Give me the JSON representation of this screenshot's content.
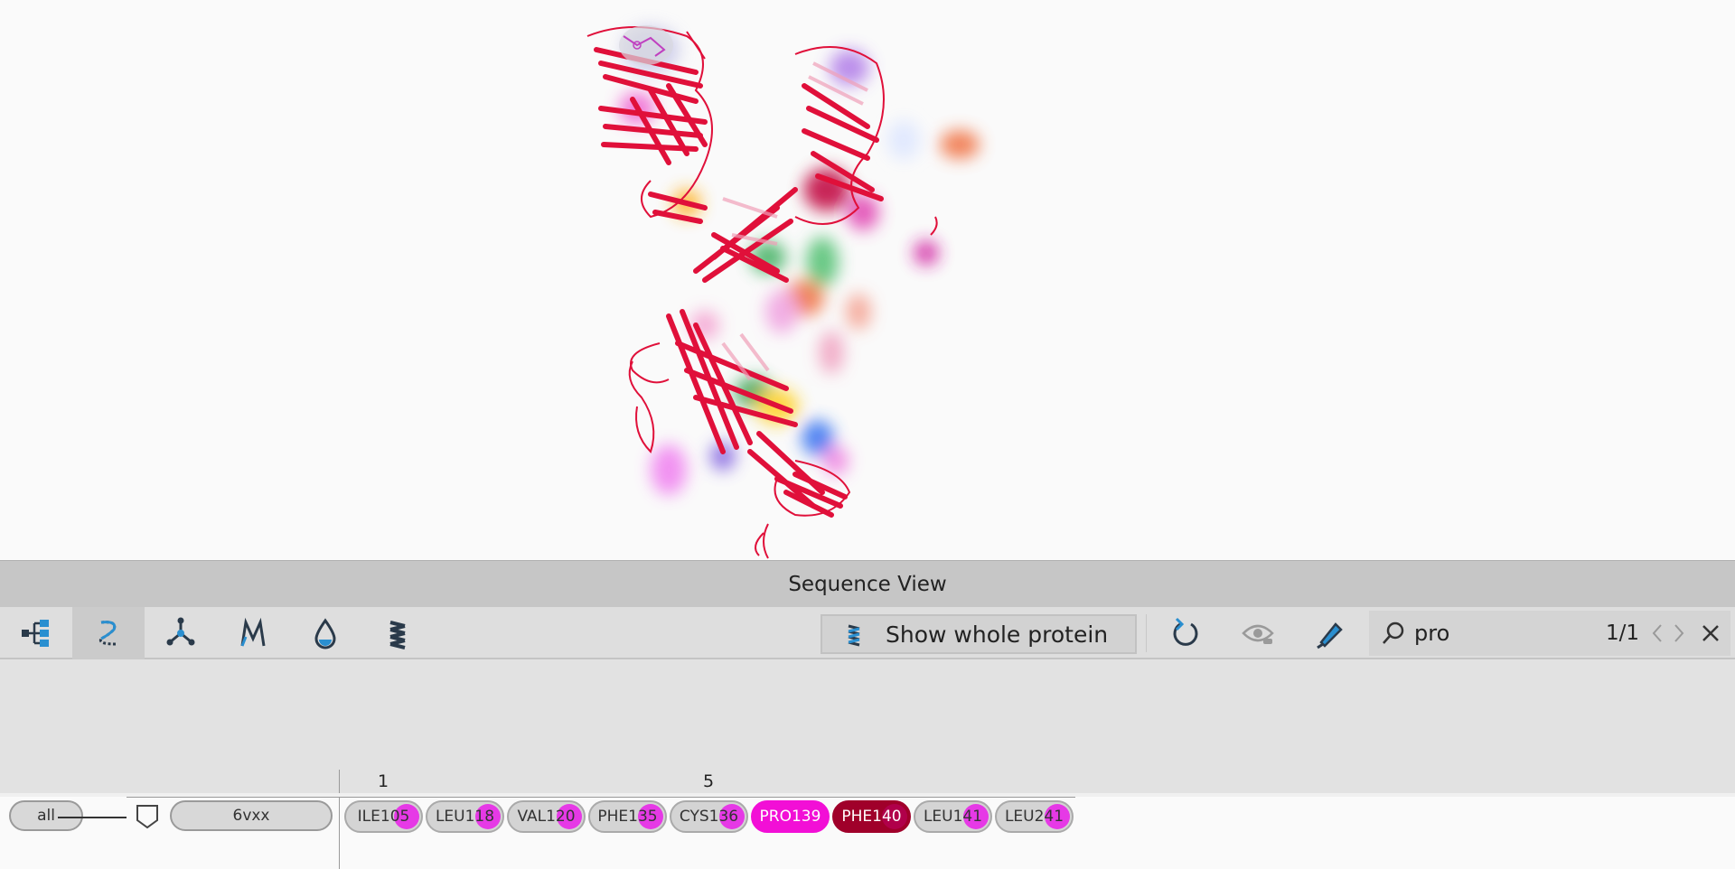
{
  "panel": {
    "title": "Sequence View"
  },
  "toolbar": {
    "show_whole_label": "Show whole protein",
    "search": {
      "value": "pro",
      "count": "1/1"
    }
  },
  "sequence": {
    "all_label": "all",
    "chain_label": "6vxx",
    "ruler": [
      "1",
      "5"
    ],
    "residues": [
      {
        "label": "ILE105",
        "state": "normal"
      },
      {
        "label": "LEU118",
        "state": "normal"
      },
      {
        "label": "VAL120",
        "state": "normal"
      },
      {
        "label": "PHE135",
        "state": "normal"
      },
      {
        "label": "CYS136",
        "state": "normal"
      },
      {
        "label": "PRO139",
        "state": "match"
      },
      {
        "label": "PHE140",
        "state": "selected"
      },
      {
        "label": "LEU141",
        "state": "normal"
      },
      {
        "label": "LEU241",
        "state": "normal"
      }
    ]
  },
  "colors": {
    "ribbon": "#e0103a",
    "match": "#f20fd6",
    "selected": "#a0002a",
    "residue_dot": "#e639e6",
    "accent": "#2a8fd0"
  },
  "icons": [
    "hierarchy-icon",
    "chain-trace-icon",
    "molecule-icon",
    "motif-icon",
    "hydrophobicity-icon",
    "helix-icon",
    "reset-icon",
    "visibility-icon",
    "highlighter-icon",
    "search-icon",
    "chevron-left-icon",
    "chevron-right-icon",
    "close-icon"
  ]
}
